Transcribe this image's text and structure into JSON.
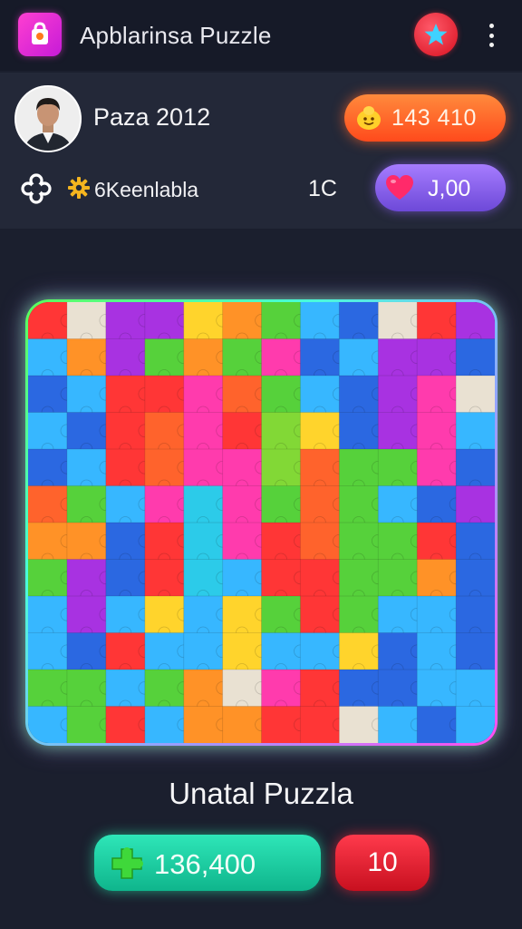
{
  "header": {
    "app_title": "Apblarinsa Puzzle",
    "app_icon": "puzzle-bag-icon",
    "star_icon": "star-icon",
    "menu_icon": "more-vertical-icon"
  },
  "profile": {
    "player_name": "Paza 2012",
    "coins": "143 410",
    "settings_label": "6Keenlabla",
    "level_count": "1C",
    "lives": "J,00"
  },
  "board": {
    "columns": 12,
    "rows": 12,
    "palette": [
      "#ff2a2a",
      "#ff8c1a",
      "#ffd21f",
      "#4ccf2f",
      "#2bb3ff",
      "#1e5fe0",
      "#a326e0",
      "#ff2fa8",
      "#ff5a1f",
      "#7bd62a",
      "#e8e0d0",
      "#1fc8e8"
    ],
    "tiles": [
      [
        0,
        10,
        6,
        6,
        2,
        1,
        3,
        4,
        5,
        10,
        0,
        6
      ],
      [
        4,
        1,
        6,
        3,
        1,
        3,
        7,
        5,
        4,
        6,
        6,
        5
      ],
      [
        5,
        4,
        0,
        0,
        7,
        8,
        3,
        4,
        5,
        6,
        7,
        10
      ],
      [
        4,
        5,
        0,
        8,
        7,
        0,
        9,
        2,
        5,
        6,
        7,
        4
      ],
      [
        5,
        4,
        0,
        8,
        7,
        7,
        9,
        8,
        3,
        3,
        7,
        5
      ],
      [
        8,
        3,
        4,
        7,
        11,
        7,
        3,
        8,
        3,
        4,
        5,
        6
      ],
      [
        1,
        1,
        5,
        0,
        11,
        7,
        0,
        8,
        3,
        3,
        0,
        5
      ],
      [
        3,
        6,
        5,
        0,
        11,
        4,
        0,
        0,
        3,
        3,
        1,
        5
      ],
      [
        4,
        6,
        4,
        2,
        4,
        2,
        3,
        0,
        3,
        4,
        4,
        5
      ],
      [
        4,
        5,
        0,
        4,
        4,
        2,
        4,
        4,
        2,
        5,
        4,
        5
      ],
      [
        3,
        3,
        4,
        3,
        1,
        10,
        7,
        0,
        5,
        5,
        4,
        4
      ],
      [
        4,
        3,
        0,
        4,
        1,
        1,
        0,
        0,
        10,
        4,
        5,
        4
      ]
    ]
  },
  "footer": {
    "puzzle_title": "Unatal Puzzla",
    "score": "136,400",
    "moves": "10"
  },
  "colors": {
    "background": "#1b1f2e",
    "coin_pill": "#ff5a1f",
    "lives_pill": "#8a5cf0",
    "score_pill": "#1cc99b",
    "moves_pill": "#e21a2d"
  }
}
